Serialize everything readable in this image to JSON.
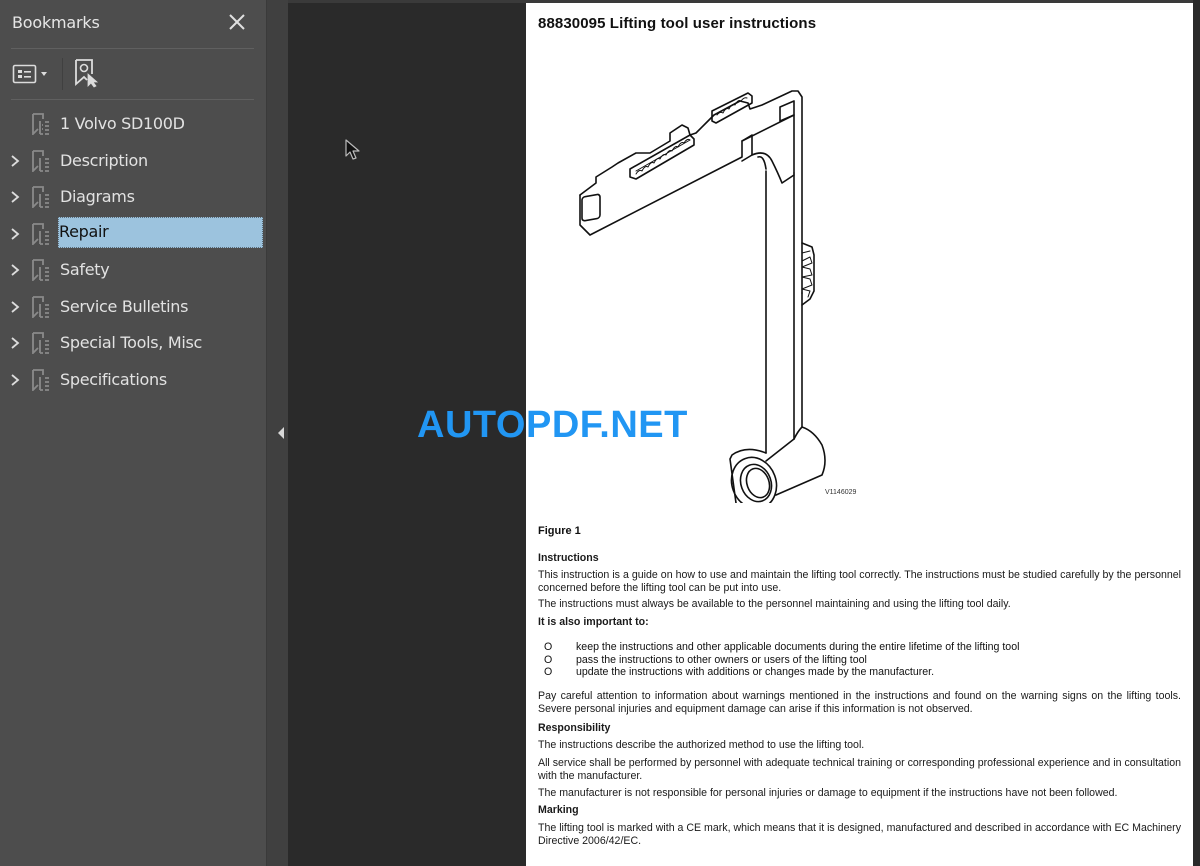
{
  "sidebar": {
    "title": "Bookmarks",
    "close_icon": "close-icon",
    "toolbar": {
      "options_icon": "list-options-icon",
      "find_icon": "find-current-bookmark-icon"
    },
    "items": [
      {
        "label": "1 Volvo SD100D",
        "expandable": false,
        "selected": false
      },
      {
        "label": "Description",
        "expandable": true,
        "selected": false
      },
      {
        "label": "Diagrams",
        "expandable": true,
        "selected": false
      },
      {
        "label": "Repair",
        "expandable": true,
        "selected": true
      },
      {
        "label": "Safety",
        "expandable": true,
        "selected": false
      },
      {
        "label": "Service Bulletins",
        "expandable": true,
        "selected": false
      },
      {
        "label": "Special Tools, Misc",
        "expandable": true,
        "selected": false
      },
      {
        "label": "Specifications",
        "expandable": true,
        "selected": false
      }
    ]
  },
  "splitter": {
    "collapse_icon": "collapse-left-icon"
  },
  "watermark": "AUTOPDF.NET",
  "colors": {
    "sidebar_bg": "#4d4d4d",
    "canvas_bg": "#2a2a2a",
    "selection": "#9cc3de",
    "watermark": "#2196f3"
  },
  "document": {
    "title": "88830095 Lifting tool user instructions",
    "figure_code": "V1146029",
    "figure_label": "Figure 1",
    "sections": {
      "instructions_heading": "Instructions",
      "instructions_p1": "This instruction is a guide on how to use and maintain the lifting tool correctly. The instructions must be studied carefully by the personnel concerned before the lifting tool can be put into use.",
      "instructions_p2": "The instructions must always be available to the personnel maintaining and using the lifting tool daily.",
      "important_heading": "It is also important to:",
      "bullet_glyph": "O",
      "bullets": [
        "keep the instructions and other applicable documents during the entire lifetime of the lifting tool",
        "pass the instructions to other owners or users of the lifting tool",
        "update the instructions with additions or changes made by the manufacturer."
      ],
      "warning_p": "Pay careful attention to information about warnings mentioned in the instructions and found on the warning signs on the lifting tools. Severe personal injuries and equipment damage can arise if this information is not observed.",
      "responsibility_heading": "Responsibility",
      "responsibility_p1": "The instructions describe the authorized method to use the lifting tool.",
      "responsibility_p2": "All service shall be performed by personnel with adequate technical training or corresponding professional experience and in consultation with the manufacturer.",
      "responsibility_p3": "The manufacturer is not responsible for personal injuries or damage to equipment if the instructions have not been followed.",
      "marking_heading": "Marking",
      "marking_p": "The lifting tool is marked with a CE mark, which means that it is designed, manufactured and described in accordance with EC Machinery Directive 2006/42/EC."
    }
  }
}
